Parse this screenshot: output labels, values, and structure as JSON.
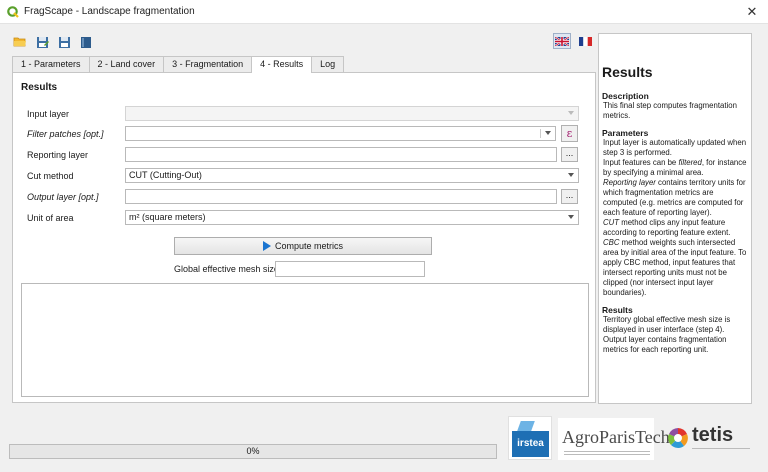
{
  "window": {
    "title": "FragScape - Landscape fragmentation"
  },
  "tabs": [
    {
      "label": "1 - Parameters"
    },
    {
      "label": "2 - Land cover"
    },
    {
      "label": "3 - Fragmentation"
    },
    {
      "label": "4 - Results"
    },
    {
      "label": "Log"
    }
  ],
  "results": {
    "heading": "Results",
    "input_layer_label": "Input layer",
    "filter_label": "Filter patches [opt.]",
    "reporting_label": "Reporting layer",
    "reporting_browse": "...",
    "cut_label": "Cut method",
    "cut_value": "CUT (Cutting-Out)",
    "output_label": "Output layer [opt.]",
    "output_browse": "...",
    "unit_label": "Unit of area",
    "unit_value": "m² (square meters)",
    "expr_glyph": "ε",
    "compute_label": "Compute metrics",
    "mesh_label": "Global effective mesh size"
  },
  "help": {
    "title": "Results",
    "desc_h": "Description",
    "desc": "This final step computes fragmentation metrics.",
    "params_h": "Parameters",
    "p1": "Input layer is automatically updated when step 3 is performed.",
    "p2a": "Input features can be",
    "p2b": "filtered",
    "p2c": ", for instance by specifying a minimal area.",
    "p3a": "Reporting layer",
    "p3b": "contains territory units for which fragmentation metrics are computed (e.g. metrics are computed for each feature of reporting layer).",
    "p4a": "CUT",
    "p4b": "method clips any input feature according to reporting feature extent.",
    "p5a": "CBC",
    "p5b": "method weights such intersected area by initial area of the input feature. To apply CBC method, input features that intersect reporting units must not be clipped (nor intersect input layer boundaries).",
    "results_h": "Results",
    "r1": "Territory global effective mesh size is displayed in user interface (step 4).",
    "r2": "Output layer contains fragmentation metrics for each reporting unit."
  },
  "progress": {
    "text": "0%",
    "value": 0
  },
  "logos": {
    "irstea": "irstea",
    "agro": "AgroParisTech",
    "tetis": "tetis"
  },
  "colors": {
    "accent": "#1a74d0",
    "progress": "#06b025",
    "expr": "#a0186b"
  }
}
